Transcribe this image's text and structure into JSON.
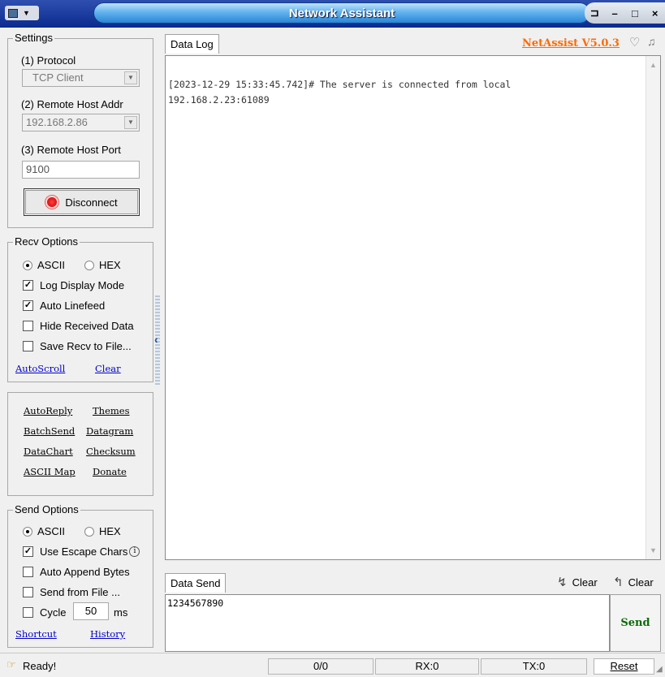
{
  "window": {
    "title": "Network Assistant",
    "controls": {
      "pin": "⊐",
      "minimize": "–",
      "maximize": "□",
      "close": "×"
    }
  },
  "settings": {
    "title": "Settings",
    "protocol_label": "(1) Protocol",
    "protocol_value": "TCP Client",
    "host_label": "(2) Remote Host Addr",
    "host_value": "192.168.2.86",
    "port_label": "(3) Remote Host Port",
    "port_value": "9100",
    "disconnect_label": "Disconnect"
  },
  "recv_options": {
    "title": "Recv Options",
    "ascii_label": "ASCII",
    "hex_label": "HEX",
    "log_display_mode": "Log Display Mode",
    "auto_linefeed": "Auto Linefeed",
    "hide_received": "Hide Received Data",
    "save_recv": "Save Recv to File...",
    "autoscroll": "AutoScroll",
    "clear": "Clear"
  },
  "tools": {
    "autoreply": "AutoReply",
    "themes": "Themes",
    "batchsend": "BatchSend",
    "datagram": "Datagram",
    "datachart": "DataChart",
    "checksum": "Checksum",
    "ascii_map": "ASCII Map",
    "donate": "Donate"
  },
  "send_options": {
    "title": "Send Options",
    "ascii_label": "ASCII",
    "hex_label": "HEX",
    "escape_chars": "Use Escape Chars",
    "auto_append": "Auto Append Bytes",
    "send_from_file": "Send from File ...",
    "cycle_label": "Cycle",
    "cycle_value": "50",
    "cycle_unit": "ms",
    "shortcut": "Shortcut",
    "history": "History"
  },
  "data_log": {
    "tab_label": "Data Log",
    "brand": "NetAssist V5.0.3",
    "lines": [
      "[2023-12-29 15:33:45.742]# The server is connected from local",
      "192.168.2.23:61089"
    ]
  },
  "data_send": {
    "tab_label": "Data Send",
    "clear1": "Clear",
    "clear2": "Clear",
    "content": "1234567890",
    "send_label": "Send"
  },
  "status": {
    "ready": "Ready!",
    "count": "0/0",
    "rx": "RX:0",
    "tx": "TX:0",
    "reset": "Reset"
  },
  "colors": {
    "brand_orange": "#ff6a00",
    "link_blue": "#0000cc",
    "send_green": "#0a6a0a"
  }
}
